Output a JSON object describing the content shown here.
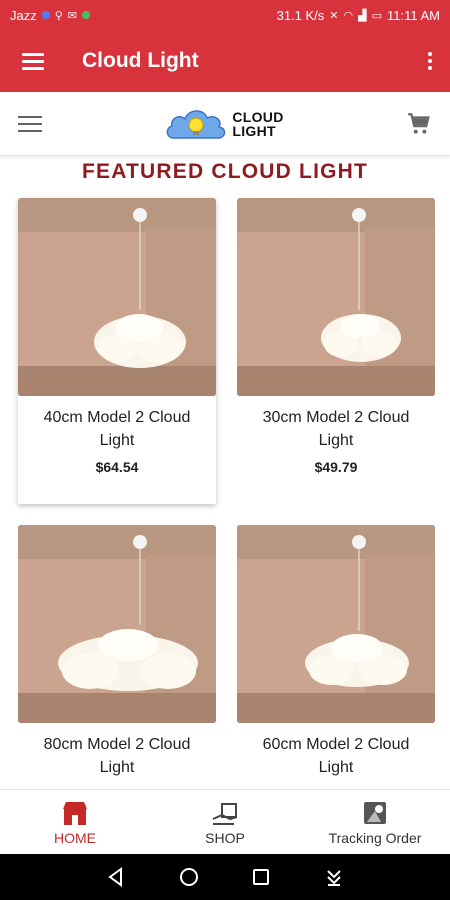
{
  "status_bar": {
    "carrier": "Jazz",
    "speed": "31.1 K/s",
    "time": "11:11 AM"
  },
  "app_bar": {
    "title": "Cloud Light",
    "menu_icon": "hamburger-icon",
    "overflow_icon": "more-vert-icon"
  },
  "site_header": {
    "menu_icon": "hamburger-icon",
    "logo_line1": "CLOUD",
    "logo_line2": "LIGHT",
    "cart_icon": "cart-icon"
  },
  "section": {
    "title": "FEATURED CLOUD LIGHT"
  },
  "products": [
    {
      "name": "40cm Model 2 Cloud Light",
      "price": "$64.54"
    },
    {
      "name": "30cm Model 2 Cloud Light",
      "price": "$49.79"
    },
    {
      "name": "80cm Model 2 Cloud Light",
      "price": ""
    },
    {
      "name": "60cm Model 2 Cloud Light",
      "price": ""
    }
  ],
  "bottom_nav": [
    {
      "label": "HOME",
      "icon": "store-icon",
      "active": true
    },
    {
      "label": "SHOP",
      "icon": "delivery-icon",
      "active": false
    },
    {
      "label": "Tracking Order",
      "icon": "map-pin-icon",
      "active": false
    }
  ],
  "colors": {
    "primary": "#d8333d",
    "heading": "#8e1b1f",
    "active_nav": "#c62828"
  }
}
